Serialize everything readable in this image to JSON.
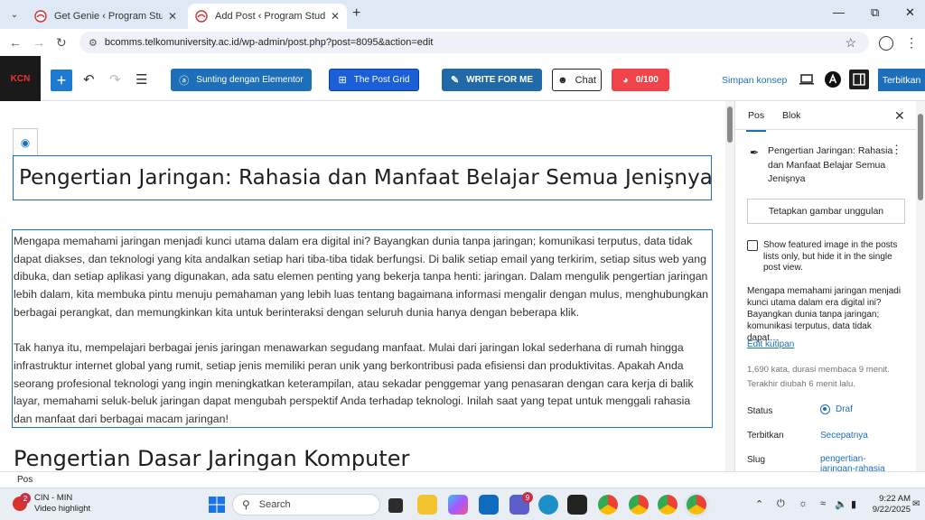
{
  "browser": {
    "tabs": [
      {
        "title": "Get Genie ‹ Program Studi Ilmu",
        "active": false
      },
      {
        "title": "Add Post ‹ Program Studi Ilmu K",
        "active": true
      }
    ],
    "url": "bcomms.telkomuniversity.ac.id/wp-admin/post.php?post=8095&action=edit"
  },
  "wp_header": {
    "elementor_label": "Sunting dengan Elementor",
    "postgrid_label": "The Post Grid",
    "writeforme_label": "WRITE FOR ME",
    "chat_label": "Chat",
    "score_label": "0/100",
    "save_draft_label": "Simpan konsep",
    "publish_label": "Terbitkan",
    "logo_text": "KCN"
  },
  "editor": {
    "title": "Pengertian Jaringan: Rahasia dan Manfaat Belajar Semua Jenişnya",
    "paragraph1": "Mengapa memahami jaringan menjadi kunci utama dalam era digital ini? Bayangkan dunia tanpa jaringan; komunikasi terputus, data tidak dapat diakses, dan teknologi yang kita andalkan setiap hari tiba-tiba tidak berfungsi. Di balik setiap email yang terkirim, setiap situs web yang dibuka, dan setiap aplikasi yang digunakan, ada satu elemen penting yang bekerja tanpa henti: jaringan. Dalam mengulik pengertian jaringan lebih dalam, kita membuka pintu menuju pemahaman yang lebih luas tentang bagaimana informasi mengalir dengan mulus, menghubungkan berbagai perangkat, dan memungkinkan kita untuk berinteraksi dengan seluruh dunia hanya dengan beberapa klik.",
    "paragraph2": "Tak hanya itu, mempelajari berbagai jenis jaringan menawarkan segudang manfaat. Mulai dari jaringan lokal sederhana di rumah hingga infrastruktur internet global yang rumit, setiap jenis memiliki peran unik yang berkontribusi pada efisiensi dan produktivitas. Apakah Anda seorang profesional teknologi yang ingin meningkatkan keterampilan, atau sekadar penggemar yang penasaran dengan cara kerja di balik layar, memahami seluk-beluk jaringan dapat mengubah perspektif Anda terhadap teknologi. Inilah saat yang tepat untuk menggali rahasia dan manfaat dari berbagai macam jaringan!",
    "heading2": "Pengertian Dasar Jaringan Komputer"
  },
  "sidebar": {
    "tab_post": "Pos",
    "tab_block": "Blok",
    "summary_title": "Pengertian Jaringan: Rahasia dan Manfaat Belajar Semua Jenişnya",
    "featured_button": "Tetapkan gambar unggulan",
    "featured_checkbox_label": "Show featured image in the posts lists only, but hide it in the single post view.",
    "excerpt": "Mengapa memahami jaringan menjadi kunci utama dalam era digital ini? Bayangkan dunia tanpa jaringan; komunikasi terputus, data tidak dapat…",
    "edit_excerpt": "Edit kutipan",
    "word_count": "1,690 kata, durasi membaca 9 menit.",
    "last_edited": "Terakhir diubah 6 menit lalu.",
    "status_label": "Status",
    "status_value": "Draf",
    "publish_label": "Terbitkan",
    "publish_value": "Secepatnya",
    "slug_label": "Slug",
    "slug_value": "pengertian-jaringan-rahasia"
  },
  "footer": {
    "breadcrumb": "Pos"
  },
  "taskbar": {
    "weather_title": "CIN - MIN",
    "weather_sub": "Video highlight",
    "weather_badge": "2",
    "search_placeholder": "Search",
    "teams_badge": "9",
    "time": "9:22 AM",
    "date": "9/22/2025"
  },
  "colors": {
    "accent": "#1e6fba",
    "score_red": "#f0444a",
    "tab_strip": "#dfe9f5"
  }
}
